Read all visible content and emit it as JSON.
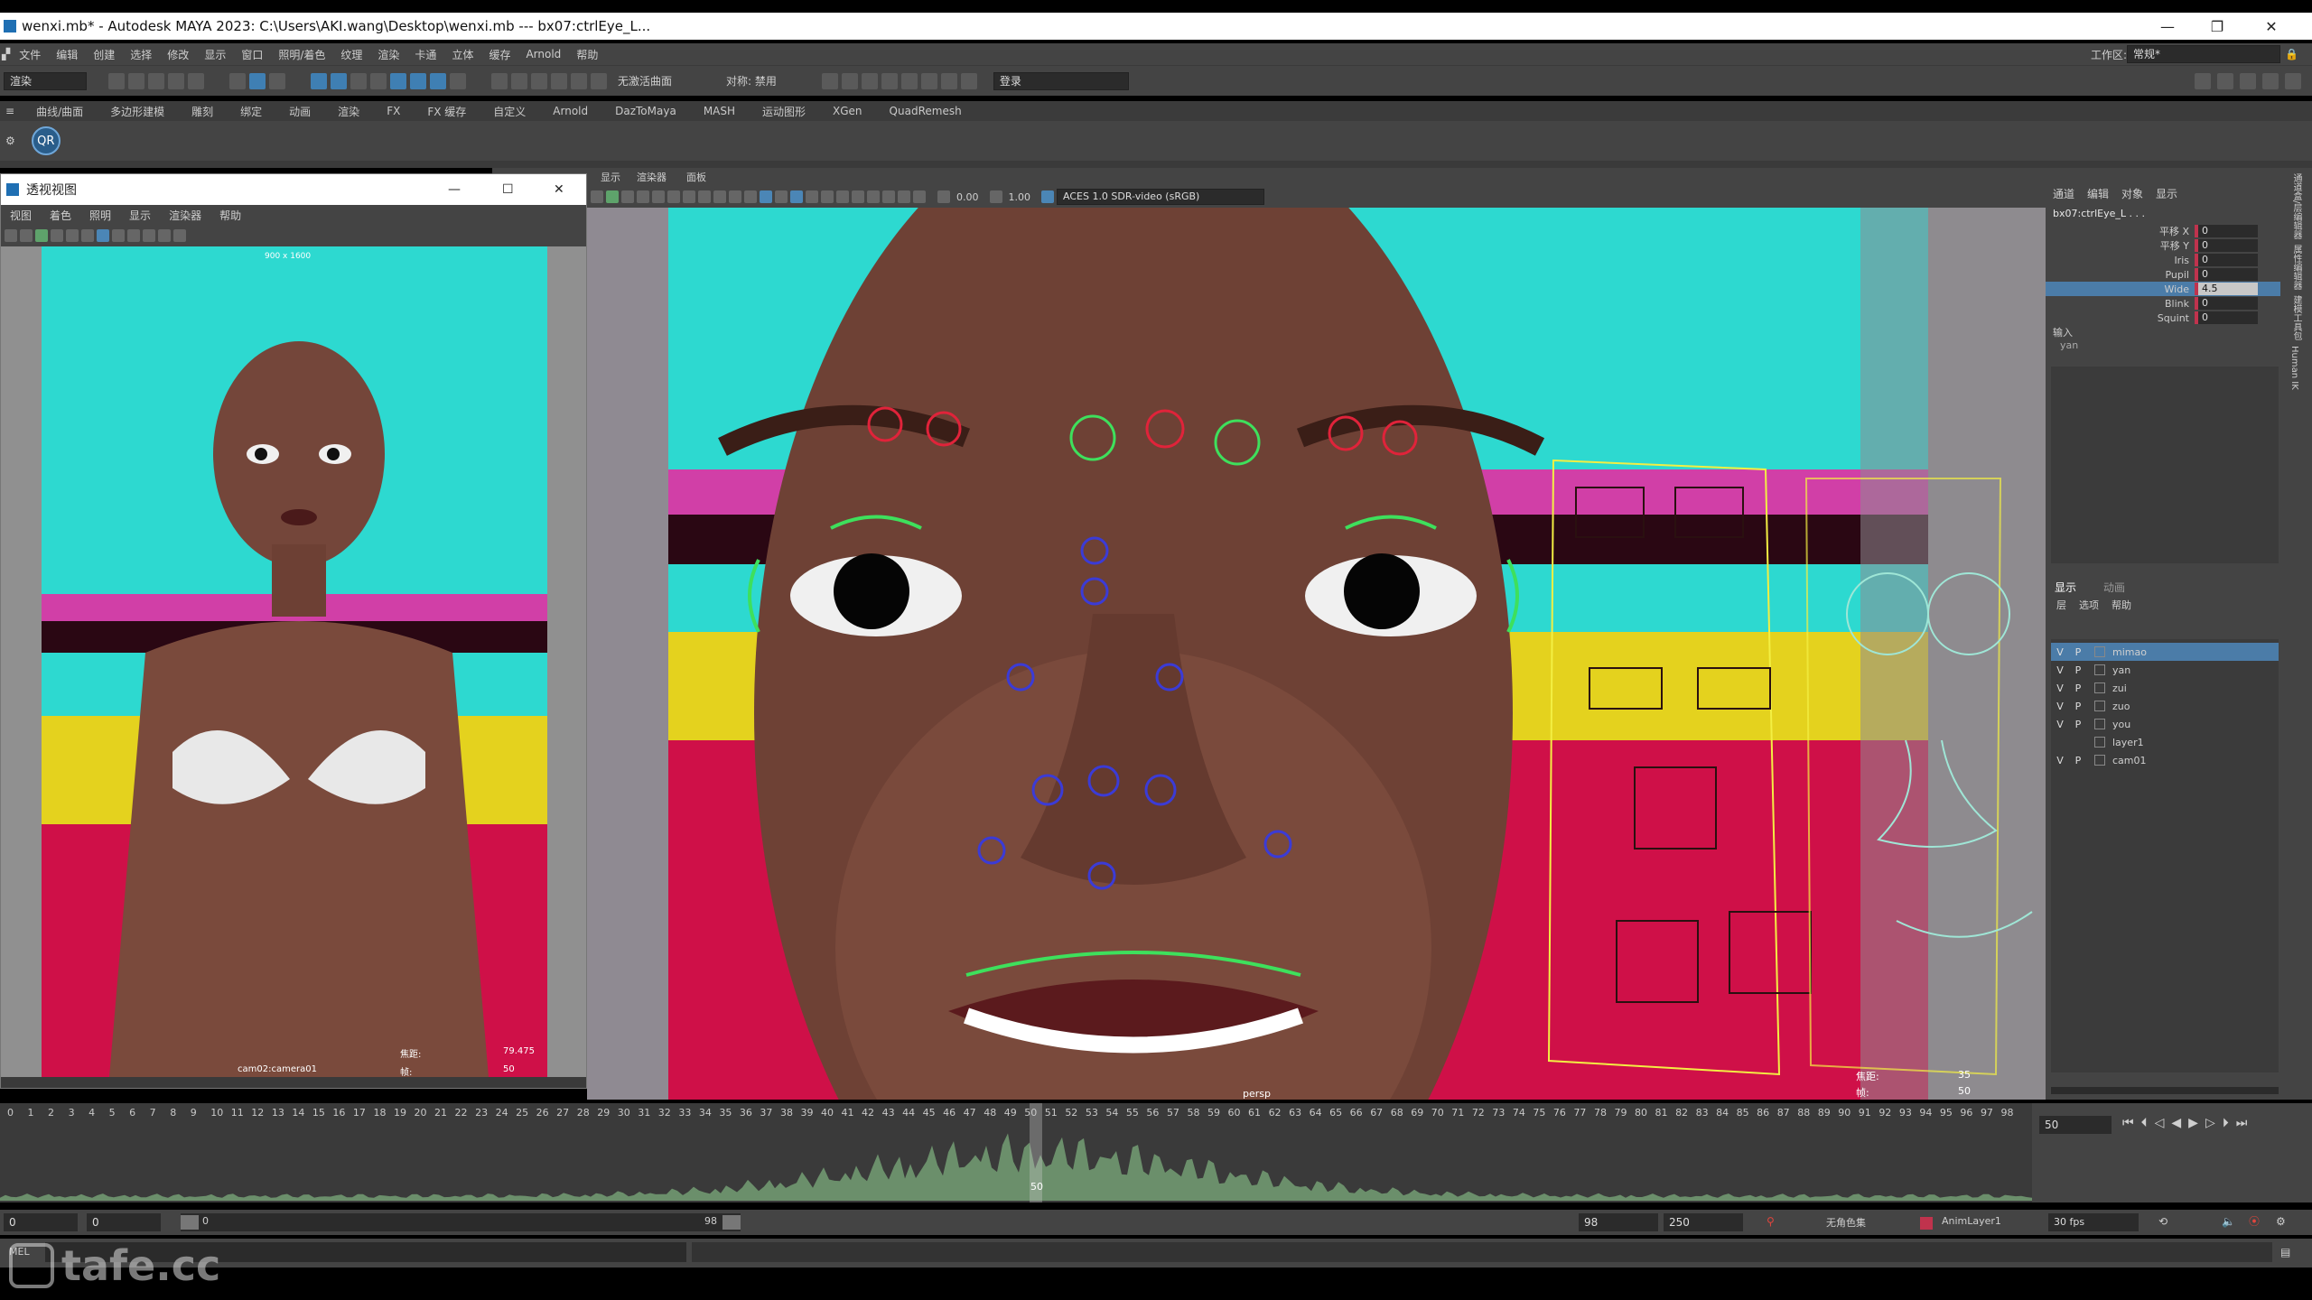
{
  "window": {
    "title": "wenxi.mb* - Autodesk MAYA 2023: C:\\Users\\AKI.wang\\Desktop\\wenxi.mb  ---  bx07:ctrlEye_L...",
    "min": "—",
    "max": "❐",
    "close": "✕"
  },
  "menubar": {
    "items": [
      "文件",
      "编辑",
      "创建",
      "选择",
      "修改",
      "显示",
      "窗口",
      "照明/着色",
      "纹理",
      "渲染",
      "卡通",
      "立体",
      "缓存",
      "Arnold",
      "帮助"
    ],
    "workspace_label": "工作区:",
    "workspace_value": "常规*"
  },
  "toolbar": {
    "mode": "渲染",
    "live_surface": "无激活曲面",
    "symmetry": "对称: 禁用",
    "login": "登录"
  },
  "shelf": {
    "tabs": [
      "曲线/曲面",
      "多边形建模",
      "雕刻",
      "绑定",
      "动画",
      "渲染",
      "FX",
      "FX 缓存",
      "自定义",
      "Arnold",
      "DazToMaya",
      "MASH",
      "运动图形",
      "XGen",
      "QuadRemesh"
    ],
    "icon_label": "QR"
  },
  "panel_menu": [
    "显示",
    "渲染器",
    "面板"
  ],
  "viewport": {
    "exposure": "0.00",
    "gamma": "1.00",
    "color_transform": "ACES 1.0 SDR-video (sRGB)",
    "camera_label": "persp",
    "hud_focal_label": "焦距:",
    "hud_focal_value": "35",
    "hud_frame_label": "帧:",
    "hud_frame_value": "50"
  },
  "persp_window": {
    "title": "透视视图",
    "menu": [
      "视图",
      "着色",
      "照明",
      "显示",
      "渲染器",
      "帮助"
    ],
    "resolution": "900 x 1600",
    "camera_label": "cam02:camera01",
    "focal_label": "焦距:",
    "focal_value": "79.475",
    "frame_label": "帧:",
    "frame_value": "50"
  },
  "channel_box": {
    "tabs": [
      "通道",
      "编辑",
      "对象",
      "显示"
    ],
    "object": "bx07:ctrlEye_L . . .",
    "attributes": [
      {
        "name": "平移 X",
        "value": "0"
      },
      {
        "name": "平移 Y",
        "value": "0"
      },
      {
        "name": "Iris",
        "value": "0"
      },
      {
        "name": "Pupil",
        "value": "0"
      },
      {
        "name": "Wide",
        "value": "4.5",
        "selected": true
      },
      {
        "name": "Blink",
        "value": "0"
      },
      {
        "name": "Squint",
        "value": "0"
      }
    ],
    "inputs_label": "输入",
    "inputs_value": "yan",
    "side_tabs": [
      "通道盒/层编辑器",
      "属性编辑器",
      "建模工具包",
      "Human IK"
    ]
  },
  "layer_editor": {
    "tabs": [
      "显示",
      "动画"
    ],
    "menu": [
      "层",
      "选项",
      "帮助"
    ],
    "layers": [
      {
        "v": "V",
        "p": "P",
        "name": "mimao",
        "selected": true
      },
      {
        "v": "V",
        "p": "P",
        "name": "yan"
      },
      {
        "v": "V",
        "p": "P",
        "name": "zui"
      },
      {
        "v": "V",
        "p": "P",
        "name": "zuo"
      },
      {
        "v": "V",
        "p": "P",
        "name": "you"
      },
      {
        "v": "",
        "p": "",
        "name": "layer1"
      },
      {
        "v": "V",
        "p": "P",
        "name": "cam01"
      }
    ]
  },
  "timeline": {
    "current_frame": "50",
    "current_field": "50",
    "ticks": [
      "0",
      "1",
      "2",
      "3",
      "4",
      "5",
      "6",
      "7",
      "8",
      "9",
      "10",
      "11",
      "12",
      "13",
      "14",
      "15",
      "16",
      "17",
      "18",
      "19",
      "20",
      "21",
      "22",
      "23",
      "24",
      "25",
      "26",
      "27",
      "28",
      "29",
      "30",
      "31",
      "32",
      "33",
      "34",
      "35",
      "36",
      "37",
      "38",
      "39",
      "40",
      "41",
      "42",
      "43",
      "44",
      "45",
      "46",
      "47",
      "48",
      "49",
      "50",
      "51",
      "52",
      "53",
      "54",
      "55",
      "56",
      "57",
      "58",
      "59",
      "60",
      "61",
      "62",
      "63",
      "64",
      "65",
      "66",
      "67",
      "68",
      "69",
      "70",
      "71",
      "72",
      "73",
      "74",
      "75",
      "76",
      "77",
      "78",
      "79",
      "80",
      "81",
      "82",
      "83",
      "84",
      "85",
      "86",
      "87",
      "88",
      "89",
      "90",
      "91",
      "92",
      "93",
      "94",
      "95",
      "96",
      "97",
      "98"
    ]
  },
  "range": {
    "start": "0",
    "start2": "0",
    "slider_start": "0",
    "slider_end": "98",
    "end": "98",
    "end2": "250",
    "char_set": "无角色集",
    "anim_layer": "AnimLayer1",
    "fps": "30 fps"
  },
  "cmdline": {
    "label": "MEL"
  },
  "watermark": "tafe.cc"
}
